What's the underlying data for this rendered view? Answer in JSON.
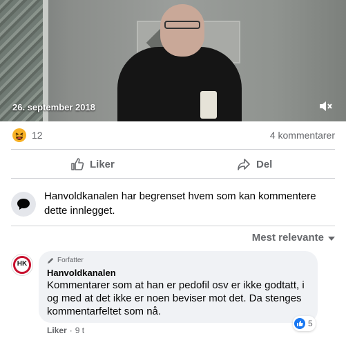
{
  "video": {
    "date": "26. september 2018",
    "mute_icon": "speaker-muted-icon"
  },
  "stats": {
    "reaction_icon": "haha-icon",
    "reaction_count": "12",
    "comment_count": "4 kommentarer"
  },
  "actions": {
    "like_label": "Liker",
    "share_label": "Del"
  },
  "restriction_notice": "Hanvoldkanalen har begrenset hvem som kan kommentere dette innlegget.",
  "sort_label": "Mest relevante",
  "comment": {
    "avatar_text": "HK",
    "badge": "Forfatter",
    "author": "Hanvoldkanalen",
    "text": "Kommentarer som at han er pedofil osv er ikke godtatt, i og med at det ikke er noen beviser mot det. Da stenges kommentarfeltet som nå.",
    "reaction_count": "5",
    "like_label": "Liker",
    "separator": "·",
    "time": "9 t"
  },
  "colors": {
    "secondary_text": "#65676b",
    "bubble_bg": "#f0f2f5",
    "like_blue": "#1877f2",
    "divider": "#ced0d4"
  }
}
